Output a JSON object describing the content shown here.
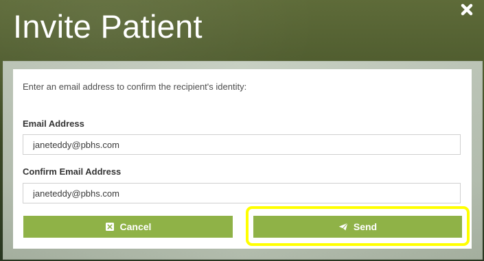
{
  "modal": {
    "title": "Invite Patient"
  },
  "form": {
    "instruction": "Enter an email address to confirm the recipient's identity:",
    "email_label": "Email Address",
    "email_value": "janeteddy@pbhs.com",
    "confirm_label": "Confirm Email Address",
    "confirm_value": "janeteddy@pbhs.com"
  },
  "actions": {
    "cancel_label": "Cancel",
    "send_label": "Send"
  },
  "icons": {
    "close": "close-icon",
    "cancel": "x-square-icon",
    "send": "paper-plane-icon"
  },
  "colors": {
    "button_green": "#8fb247",
    "highlight_yellow": "#ffff00",
    "header_green": "#4e5b2e"
  }
}
